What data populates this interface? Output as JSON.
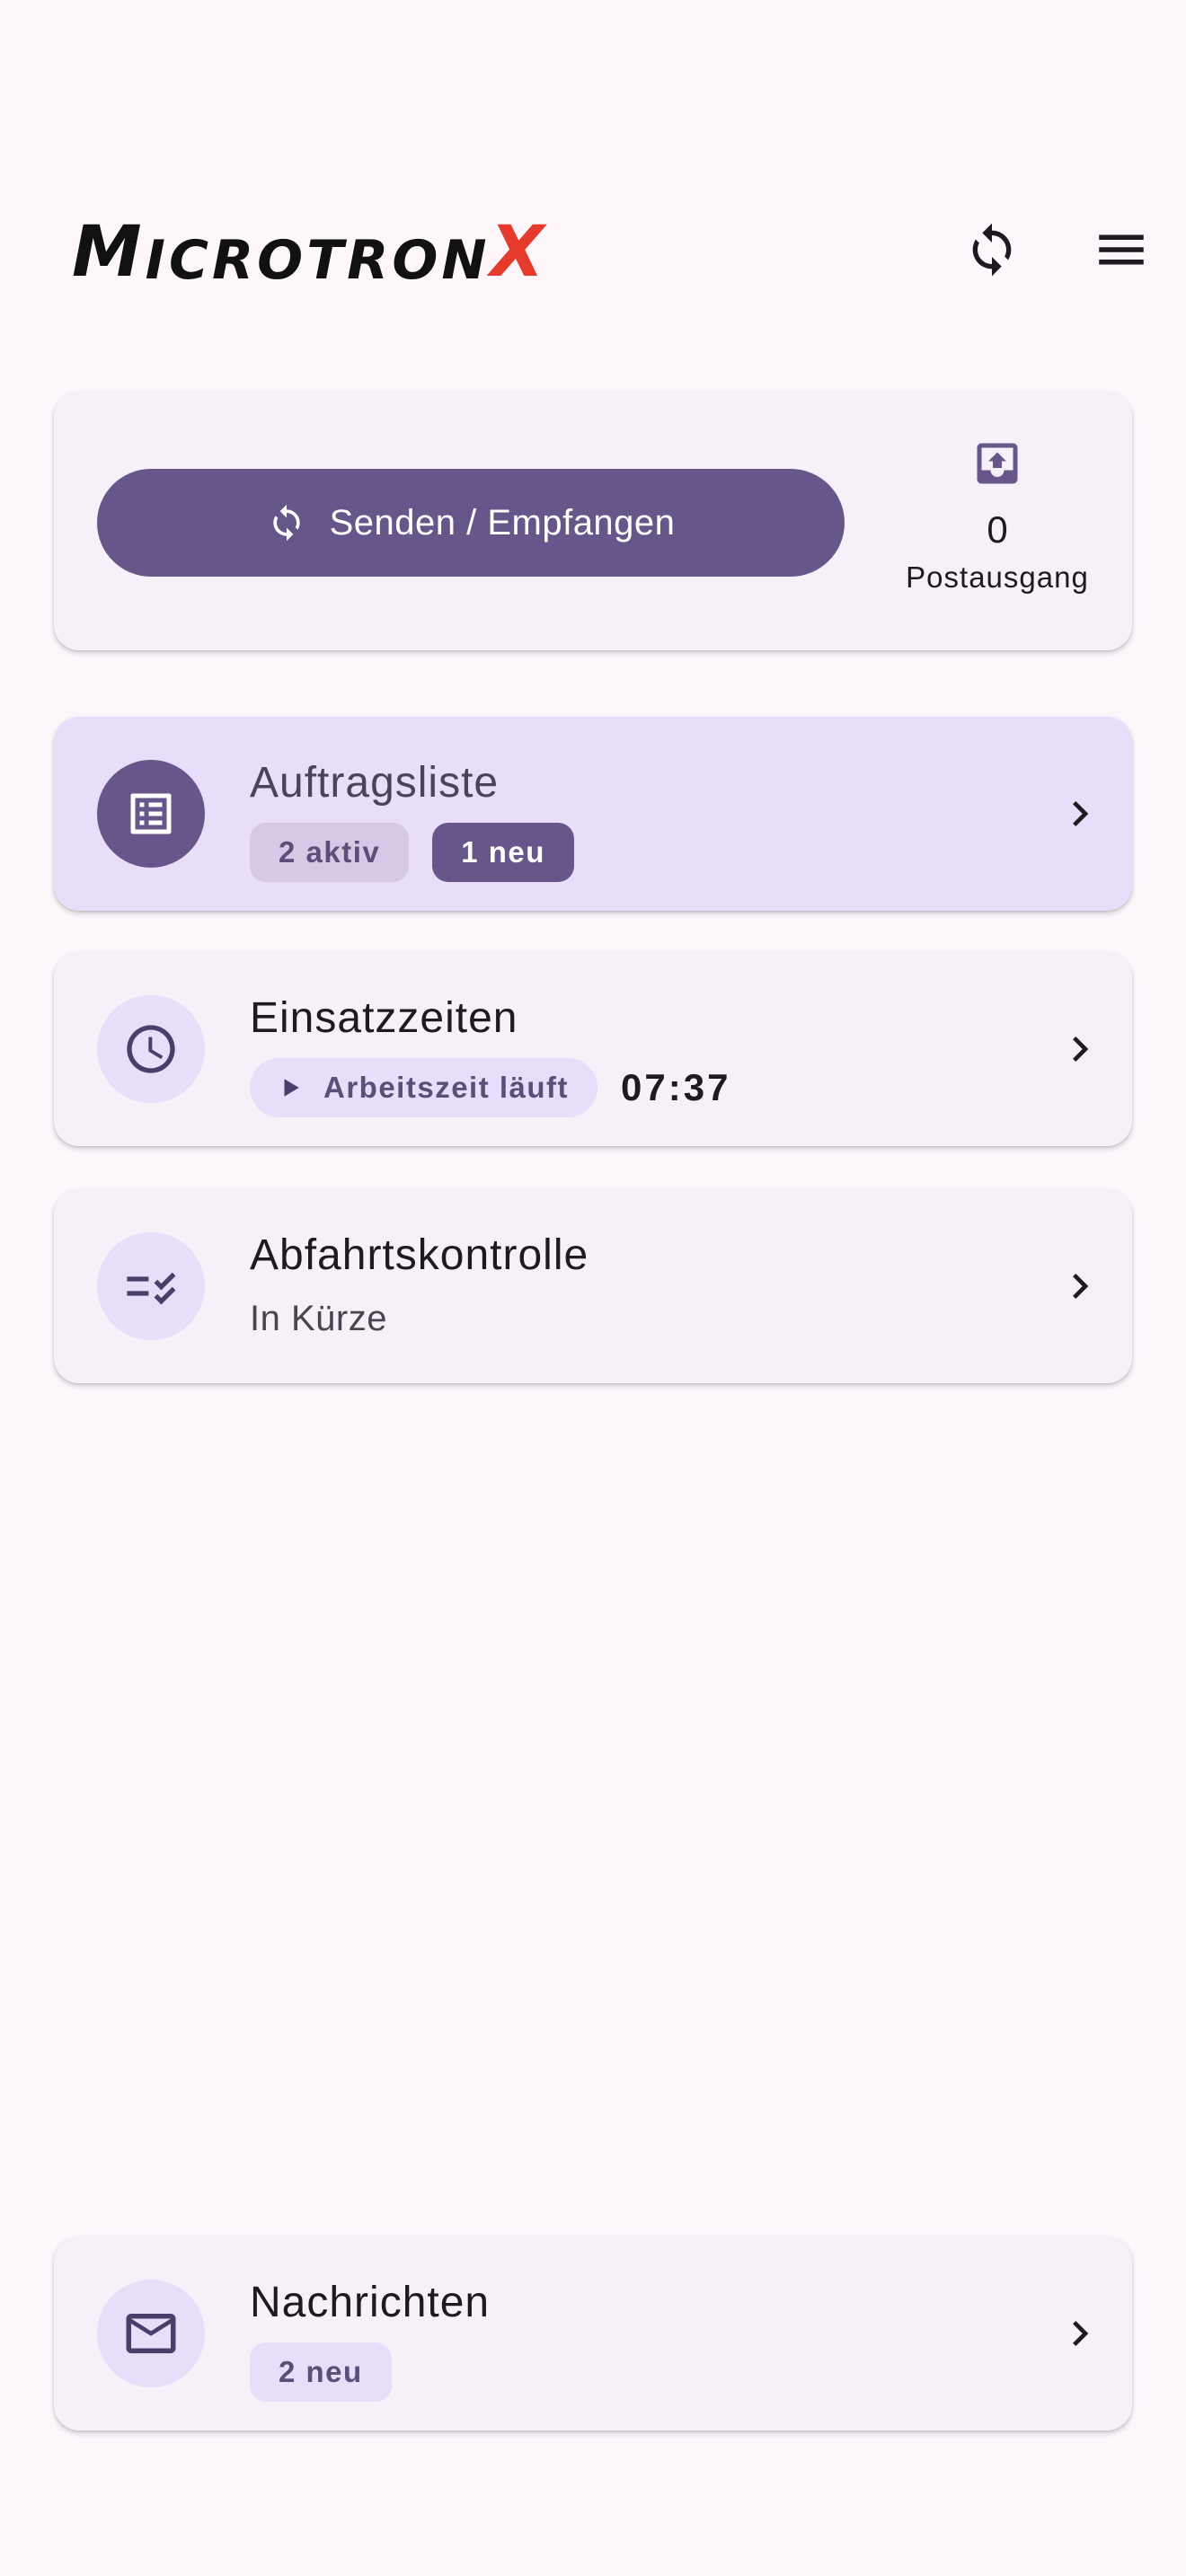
{
  "header": {
    "logo": {
      "m": "M",
      "icrotron": "ICROTRON",
      "x": "X"
    },
    "sync_icon": "sync-icon",
    "menu_icon": "menu-icon"
  },
  "sync_panel": {
    "button_label": "Senden / Empfangen",
    "outbox_count": "0",
    "outbox_label": "Postausgang"
  },
  "nav": {
    "orders": {
      "title": "Auftragsliste",
      "active_chip": "2 aktiv",
      "new_chip": "1 neu"
    },
    "times": {
      "title": "Einsatzzeiten",
      "status_chip": "Arbeitszeit läuft",
      "timer": "07:37"
    },
    "check": {
      "title": "Abfahrtskontrolle",
      "subtitle": "In Kürze"
    },
    "messages": {
      "title": "Nachrichten",
      "new_chip": "2 neu"
    }
  },
  "colors": {
    "primary": "#67568a",
    "primary_container": "#e8defa",
    "background": "#fdf7fc",
    "surface": "#f6f1f8",
    "logo_accent": "#e53a2c"
  }
}
